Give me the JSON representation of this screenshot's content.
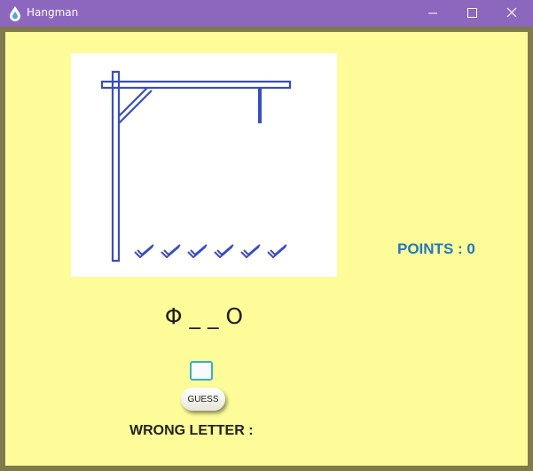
{
  "window": {
    "title": "Hangman",
    "icon": "water-drop-icon"
  },
  "titlebar_buttons": {
    "minimize": "minimize-icon",
    "maximize": "maximize-icon",
    "close": "close-icon"
  },
  "game": {
    "points_label": "POINTS : 0",
    "word_display": "Φ _ _ O",
    "guess_button": "GUESS",
    "letter_input_value": "",
    "wrong_letters_label": "WRONG LETTER :",
    "remaining_lives": 6
  },
  "colors": {
    "titlebar": "#8c67bd",
    "background": "#fdfc98",
    "gallows": "#3a4dc0",
    "points": "#2378bd",
    "input_border": "#3ab0c4"
  }
}
